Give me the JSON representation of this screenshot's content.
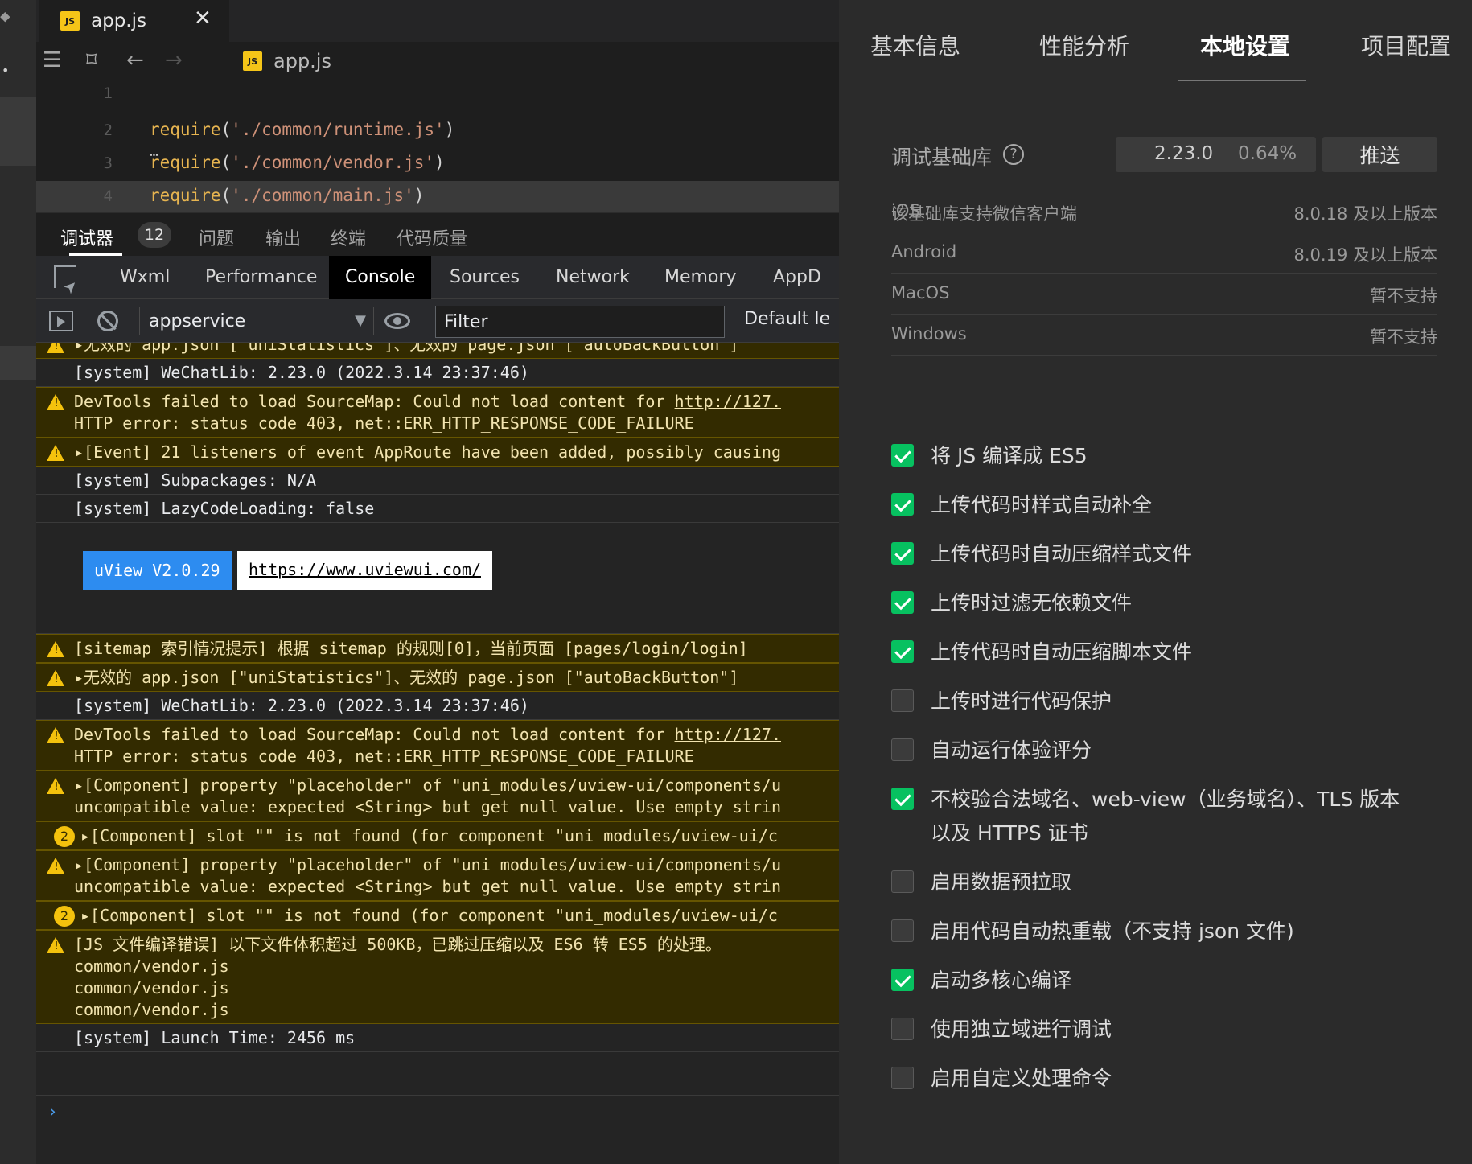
{
  "editor": {
    "tab_label": "app.js",
    "tab_close": "✕",
    "breadcrumb_file": "app.js",
    "js_badge": "JS",
    "lines": [
      {
        "num": "1",
        "fn": "",
        "str": ""
      },
      {
        "num": "2",
        "fn": "require",
        "str": "'./common/runtime.js'"
      },
      {
        "num": "3",
        "fn": "require",
        "str": "'./common/vendor.js'"
      },
      {
        "num": "4",
        "fn": "require",
        "str": "'./common/main.js'"
      }
    ]
  },
  "panel_tabs": [
    {
      "label": "调试器",
      "badge": "12"
    },
    {
      "label": "问题"
    },
    {
      "label": "输出"
    },
    {
      "label": "终端"
    },
    {
      "label": "代码质量"
    }
  ],
  "devtools_tabs": [
    "Wxml",
    "Performance",
    "Console",
    "Sources",
    "Network",
    "Memory",
    "AppD"
  ],
  "devtools_active": "Console",
  "console_toolbar": {
    "context": "appservice",
    "filter_placeholder": "Filter",
    "levels": "Default le"
  },
  "console_rows": [
    {
      "kind": "warn",
      "icon": "warn",
      "lines": [
        "▸无效的 app.json [\"uniStatistics\"]、无效的 page.json [\"autoBackButton\"]"
      ]
    },
    {
      "kind": "info",
      "lines": [
        "[system] WeChatLib: 2.23.0 (2022.3.14 23:37:46)"
      ]
    },
    {
      "kind": "warn",
      "icon": "warn",
      "lines": [
        "DevTools failed to load SourceMap: Could not load content for http://127.",
        "HTTP error: status code 403, net::ERR_HTTP_RESPONSE_CODE_FAILURE"
      ]
    },
    {
      "kind": "warn",
      "icon": "warn",
      "lines": [
        "▸[Event] 21 listeners of event AppRoute have been added, possibly causing"
      ]
    },
    {
      "kind": "info",
      "lines": [
        "[system] Subpackages: N/A"
      ]
    },
    {
      "kind": "info",
      "lines": [
        "[system] LazyCodeLoading: false"
      ]
    },
    {
      "kind": "uview",
      "tag": "uView V2.0.29",
      "link": "https://www.uviewui.com/"
    },
    {
      "kind": "warn",
      "icon": "warn",
      "lines": [
        "[sitemap 索引情况提示] 根据 sitemap 的规则[0]，当前页面 [pages/login/login]"
      ]
    },
    {
      "kind": "warn",
      "icon": "warn",
      "lines": [
        "▸无效的 app.json [\"uniStatistics\"]、无效的 page.json [\"autoBackButton\"]"
      ]
    },
    {
      "kind": "info",
      "lines": [
        "[system] WeChatLib: 2.23.0 (2022.3.14 23:37:46)"
      ]
    },
    {
      "kind": "warn",
      "icon": "warn",
      "lines": [
        "DevTools failed to load SourceMap: Could not load content for http://127.",
        "HTTP error: status code 403, net::ERR_HTTP_RESPONSE_CODE_FAILURE"
      ]
    },
    {
      "kind": "warn",
      "icon": "warn",
      "lines": [
        "▸[Component] property \"placeholder\" of \"uni_modules/uview-ui/components/u",
        "uncompatible value: expected <String> but get null value. Use empty strin"
      ]
    },
    {
      "kind": "warn",
      "icon": "count",
      "count": "2",
      "lines": [
        "▸[Component] slot \"\" is not found (for component \"uni_modules/uview-ui/c"
      ]
    },
    {
      "kind": "warn",
      "icon": "warn",
      "lines": [
        "▸[Component] property \"placeholder\" of \"uni_modules/uview-ui/components/u",
        "uncompatible value: expected <String> but get null value. Use empty strin"
      ]
    },
    {
      "kind": "warn",
      "icon": "count",
      "count": "2",
      "lines": [
        "▸[Component] slot \"\" is not found (for component \"uni_modules/uview-ui/c"
      ]
    },
    {
      "kind": "warn",
      "icon": "warn",
      "lines": [
        "[JS 文件编译错误] 以下文件体积超过 500KB，已跳过压缩以及 ES6 转 ES5 的处理。",
        "common/vendor.js",
        "common/vendor.js",
        "common/vendor.js"
      ]
    },
    {
      "kind": "info",
      "lines": [
        "[system] Launch Time: 2456 ms"
      ]
    }
  ],
  "prompt_symbol": "›",
  "settings": {
    "tabs": [
      "基本信息",
      "性能分析",
      "本地设置",
      "项目配置"
    ],
    "active_tab": "本地设置",
    "lib_label": "调试基础库",
    "lib_help": "?",
    "lib_version": "2.23.0",
    "lib_percent": "0.64%",
    "push_label": "推送",
    "support_title": "该基础库支持微信客户端",
    "platforms": [
      {
        "name": "iOS",
        "value": "8.0.18 及以上版本"
      },
      {
        "name": "Android",
        "value": "8.0.19 及以上版本"
      },
      {
        "name": "MacOS",
        "value": "暂不支持"
      },
      {
        "name": "Windows",
        "value": "暂不支持"
      }
    ],
    "options": [
      {
        "label": "将 JS 编译成 ES5",
        "checked": true
      },
      {
        "label": "上传代码时样式自动补全",
        "checked": true
      },
      {
        "label": "上传代码时自动压缩样式文件",
        "checked": true
      },
      {
        "label": "上传时过滤无依赖文件",
        "checked": true
      },
      {
        "label": "上传代码时自动压缩脚本文件",
        "checked": true
      },
      {
        "label": "上传时进行代码保护",
        "checked": false
      },
      {
        "label": "自动运行体验评分",
        "checked": false
      },
      {
        "label": "不校验合法域名、web-view（业务域名）、TLS 版本以及 HTTPS 证书",
        "checked": true
      },
      {
        "label": "启用数据预拉取",
        "checked": false
      },
      {
        "label": "启用代码自动热重载（不支持 json 文件)",
        "checked": false
      },
      {
        "label": "启动多核心编译",
        "checked": true
      },
      {
        "label": "使用独立域进行调试",
        "checked": false
      },
      {
        "label": "启用自定义处理命令",
        "checked": false
      }
    ]
  }
}
